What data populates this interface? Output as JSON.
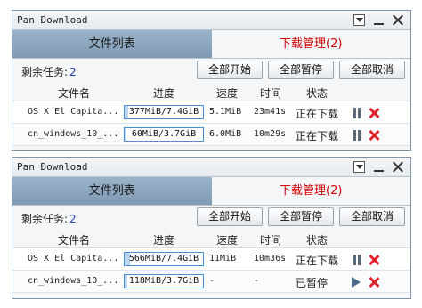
{
  "windows": [
    {
      "title": "Pan Download",
      "tabs": {
        "files": "文件列表",
        "downloads": "下载管理(2)"
      },
      "task_label": "剩余任务:",
      "task_count": "2",
      "buttons": {
        "start_all": "全部开始",
        "pause_all": "全部暂停",
        "cancel_all": "全部取消"
      },
      "columns": {
        "name": "文件名",
        "progress": "进度",
        "speed": "速度",
        "time": "时间",
        "status": "状态"
      },
      "rows": [
        {
          "name": "OS X El Capita...",
          "progress_text": "377MiB/7.4GiB",
          "progress_fraction": 0.05,
          "speed": "5.1MiB",
          "time": "23m41s",
          "status": "正在下载",
          "action": "pause-icon"
        },
        {
          "name": "cn_windows_10_...",
          "progress_text": "60MiB/3.7GiB",
          "progress_fraction": 0.02,
          "speed": "6.0MiB",
          "time": "10m29s",
          "status": "正在下载",
          "action": "pause-icon"
        }
      ]
    },
    {
      "title": "Pan Download",
      "tabs": {
        "files": "文件列表",
        "downloads": "下载管理(2)"
      },
      "task_label": "剩余任务:",
      "task_count": "2",
      "buttons": {
        "start_all": "全部开始",
        "pause_all": "全部暂停",
        "cancel_all": "全部取消"
      },
      "columns": {
        "name": "文件名",
        "progress": "进度",
        "speed": "速度",
        "time": "时间",
        "status": "状态"
      },
      "rows": [
        {
          "name": "OS X El Capita...",
          "progress_text": "566MiB/7.4GiB",
          "progress_fraction": 0.07,
          "speed": "11MiB",
          "time": "10m36s",
          "status": "正在下载",
          "action": "pause-icon"
        },
        {
          "name": "cn_windows_10_...",
          "progress_text": "118MiB/3.7GiB",
          "progress_fraction": 0.03,
          "speed": "-",
          "time": "-",
          "status": "已暂停",
          "action": "play-icon"
        }
      ]
    }
  ],
  "colors": {
    "active_tab_text": "#d00000",
    "delete_icon": "#e0202a",
    "progress_border": "#4a90d9"
  }
}
